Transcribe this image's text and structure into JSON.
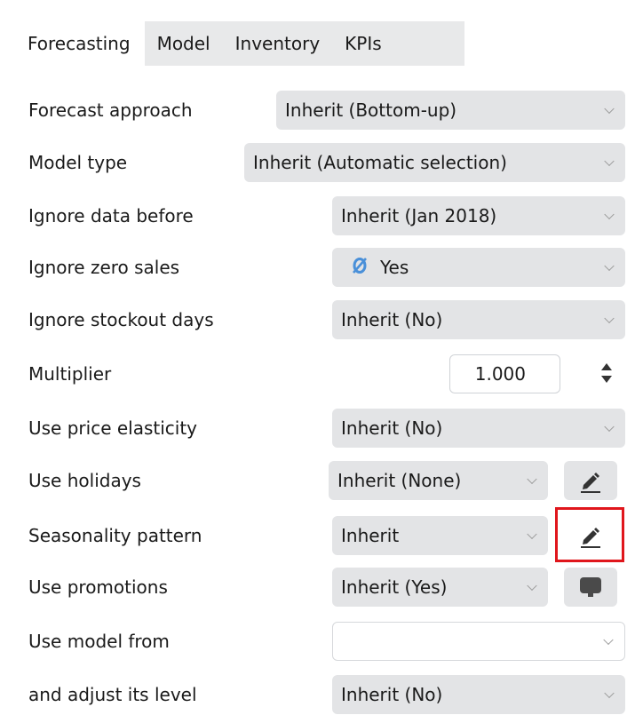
{
  "tabs": [
    {
      "label": "Forecasting",
      "active": true
    },
    {
      "label": "Model"
    },
    {
      "label": "Inventory"
    },
    {
      "label": "KPIs"
    }
  ],
  "rows": {
    "forecast_approach": {
      "label": "Forecast approach",
      "value": "Inherit (Bottom-up)"
    },
    "model_type": {
      "label": "Model type",
      "value": "Inherit (Automatic selection)"
    },
    "ignore_data_before": {
      "label": "Ignore data before",
      "value": "Inherit (Jan 2018)"
    },
    "ignore_zero_sales": {
      "label": "Ignore zero sales",
      "value": "Yes",
      "icon": "override-link-icon"
    },
    "ignore_stockout_days": {
      "label": "Ignore stockout days",
      "value": "Inherit (No)"
    },
    "multiplier": {
      "label": "Multiplier",
      "value": "1.000"
    },
    "use_price_elasticity": {
      "label": "Use price elasticity",
      "value": "Inherit (No)"
    },
    "use_holidays": {
      "label": "Use holidays",
      "value": "Inherit (None)",
      "button_icon": "pencil-icon"
    },
    "seasonality_pattern": {
      "label": "Seasonality pattern",
      "value": "Inherit",
      "button_icon": "pencil-icon"
    },
    "use_promotions": {
      "label": "Use promotions",
      "value": "Inherit (Yes)",
      "button_icon": "monitor-icon"
    },
    "use_model_from": {
      "label": "Use model from",
      "value": ""
    },
    "adjust_level": {
      "label": "and adjust its level",
      "value": "Inherit (No)"
    }
  },
  "colors": {
    "highlight": "#e0161c",
    "control_bg": "#e3e4e6",
    "tabbar_bg": "#e8e9ea",
    "yes_icon": "#4a90d9"
  }
}
